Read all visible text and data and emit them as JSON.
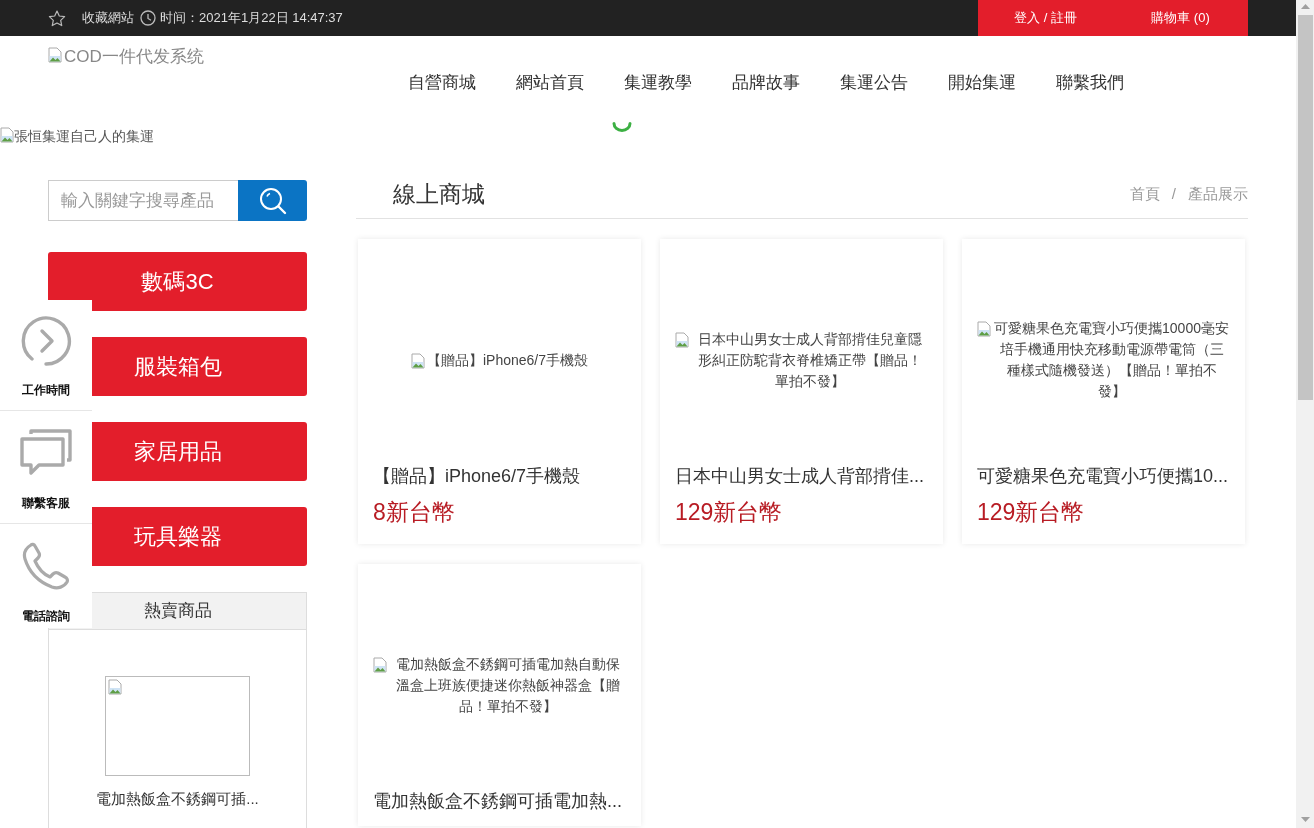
{
  "top_bar": {
    "favorite": "收藏網站",
    "time": "时间：2021年1月22日 14:47:37",
    "links": [
      "登入 / 註冊",
      "購物車 (0)"
    ]
  },
  "header": {
    "logo_alt": "COD一件代发系统",
    "nav": [
      "自營商城",
      "網站首頁",
      "集運教學",
      "品牌故事",
      "集運公告",
      "開始集運",
      "聯繫我們"
    ]
  },
  "banner": {
    "image_alt": "張恒集運自己人的集運"
  },
  "sidebar": {
    "search": {
      "placeholder": "輸入關鍵字搜尋產品"
    },
    "categories": [
      "數碼3C",
      "服裝箱包",
      "家居用品",
      "玩具樂器"
    ],
    "hot": {
      "title": "熱賣商品",
      "items": [
        {
          "name": "電加熱飯盒不銹鋼可插..."
        }
      ]
    }
  },
  "float_tools": [
    {
      "label": "工作時間"
    },
    {
      "label": "聯繫客服"
    },
    {
      "label": "電話諮詢"
    }
  ],
  "main": {
    "title": "線上商城",
    "breadcrumb": {
      "items": [
        "首頁",
        "產品展示"
      ],
      "separator": "/"
    },
    "products": [
      {
        "image_alt": "【贈品】iPhone6/7手機殼",
        "title": "【贈品】iPhone6/7手機殼",
        "price": "8新台幣"
      },
      {
        "image_alt": "日本中山男女士成人背部揹佳兒童隱形糾正防駝背衣脊椎矯正帶【贈品！單拍不發】",
        "title": "日本中山男女士成人背部揹佳...",
        "price": "129新台幣"
      },
      {
        "image_alt": "可愛糖果色充電寶小巧便攜10000毫安培手機通用快充移動電源帶電筒（三種樣式隨機發送）【贈品！單拍不發】",
        "title": "可愛糖果色充電寶小巧便攜10...",
        "price": "129新台幣"
      },
      {
        "image_alt": "電加熱飯盒不銹鋼可插電加熱自動保溫盒上班族便捷迷你熱飯神器盒【贈品！單拍不發】",
        "title": "電加熱飯盒不銹鋼可插電加熱..."
      }
    ]
  }
}
